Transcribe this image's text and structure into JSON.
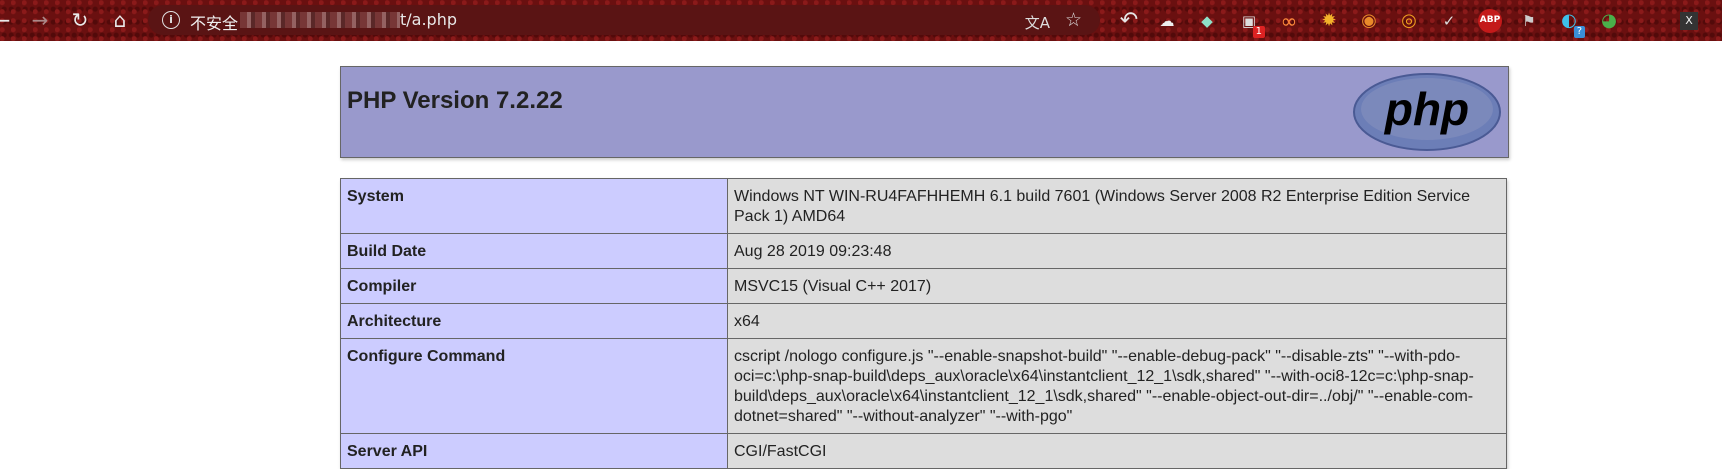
{
  "browser": {
    "address_prefix": "不安全",
    "url_suffix": "t/a.php",
    "extensions": [
      {
        "icon": "reply-icon"
      },
      {
        "icon": "extension-cloud-icon"
      },
      {
        "icon": "extension-diamond-icon"
      },
      {
        "icon": "extension-robot-icon",
        "badge": "1"
      },
      {
        "icon": "extension-infinity-icon"
      },
      {
        "icon": "extension-gear-icon"
      },
      {
        "icon": "extension-fox-icon"
      },
      {
        "icon": "extension-ring-icon"
      },
      {
        "icon": "checkmark-icon"
      },
      {
        "icon": "adblock-icon",
        "label": "ABP"
      },
      {
        "icon": "bookmark-icon"
      },
      {
        "icon": "extension-question-icon",
        "badge": "?"
      },
      {
        "icon": "extension-globe-icon"
      },
      {
        "icon": "extension-x-icon",
        "label": "X"
      }
    ]
  },
  "phpinfo": {
    "title": "PHP Version 7.2.22",
    "logo_text": "php",
    "rows": [
      {
        "key": "System",
        "value": "Windows NT WIN-RU4FAFHHEMH 6.1 build 7601 (Windows Server 2008 R2 Enterprise Edition Service Pack 1) AMD64"
      },
      {
        "key": "Build Date",
        "value": "Aug 28 2019 09:23:48"
      },
      {
        "key": "Compiler",
        "value": "MSVC15 (Visual C++ 2017)"
      },
      {
        "key": "Architecture",
        "value": "x64"
      },
      {
        "key": "Configure Command",
        "value": "cscript /nologo configure.js \"--enable-snapshot-build\" \"--enable-debug-pack\" \"--disable-zts\" \"--with-pdo-oci=c:\\php-snap-build\\deps_aux\\oracle\\x64\\instantclient_12_1\\sdk,shared\" \"--with-oci8-12c=c:\\php-snap-build\\deps_aux\\oracle\\x64\\instantclient_12_1\\sdk,shared\" \"--enable-object-out-dir=../obj/\" \"--enable-com-dotnet=shared\" \"--without-analyzer\" \"--with-pgo\""
      },
      {
        "key": "Server API",
        "value": "CGI/FastCGI"
      }
    ]
  },
  "colors": {
    "header_bg": "#9999cc",
    "key_bg": "#ccccff",
    "value_bg": "#dddddd",
    "toolbar_bg": "#6a1010"
  }
}
